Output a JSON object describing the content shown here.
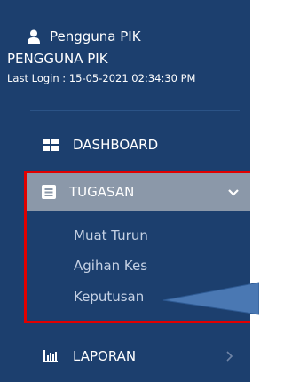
{
  "user": {
    "name": "Pengguna PIK",
    "role": "PENGGUNA PIK",
    "last_login": "Last Login : 15-05-2021 02:34:30 PM"
  },
  "menu": {
    "dashboard": {
      "label": "DASHBOARD",
      "icon": "grid-icon"
    },
    "tugasan": {
      "label": "TUGASAN",
      "icon": "task-icon",
      "expanded": true
    },
    "submenu": [
      {
        "label": "Muat Turun"
      },
      {
        "label": "Agihan Kes"
      },
      {
        "label": "Keputusan"
      }
    ],
    "laporan": {
      "label": "LAPORAN",
      "icon": "chart-icon"
    }
  },
  "colors": {
    "sidebar_bg": "#1c3f6e",
    "active_bg": "#8b98a9",
    "highlight_border": "#e10000",
    "callout_fill": "#4a78b3"
  }
}
